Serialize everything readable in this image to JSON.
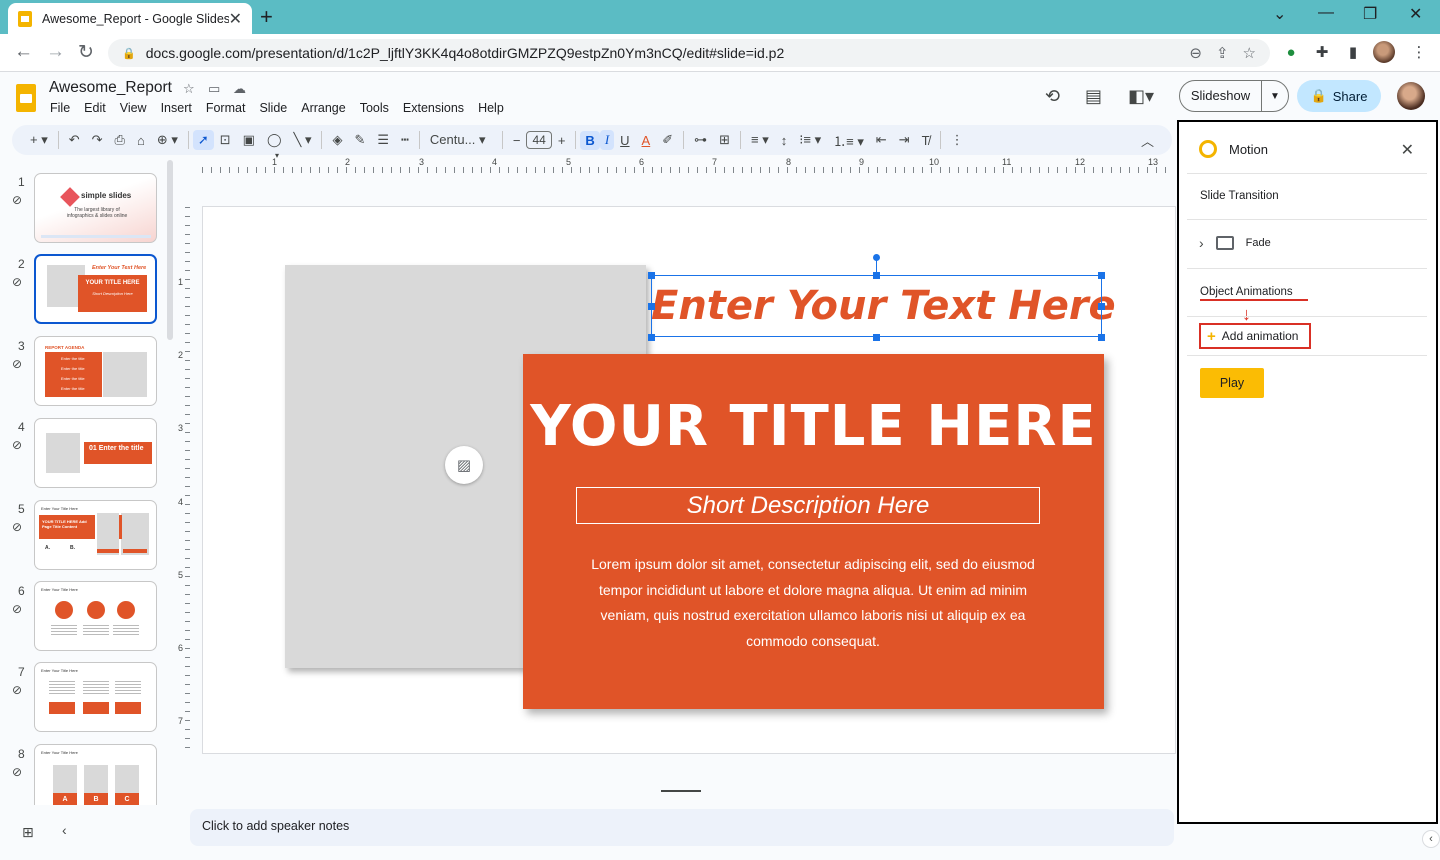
{
  "browser": {
    "tab_title": "Awesome_Report - Google Slides",
    "tab_close": "✕",
    "new_tab": "+",
    "url": "docs.google.com/presentation/d/1c2P_ljftlY3KK4q4o8otdirGMZPZQ9estpZn0Ym3nCQ/edit#slide=id.p2",
    "window_controls": [
      "⌄",
      "—",
      "❐",
      "✕"
    ]
  },
  "app": {
    "doc_title": "Awesome_Report",
    "menu": [
      "File",
      "Edit",
      "View",
      "Insert",
      "Format",
      "Slide",
      "Arrange",
      "Tools",
      "Extensions",
      "Help"
    ],
    "slideshow_label": "Slideshow",
    "share_label": "Share"
  },
  "toolbar": {
    "font_name": "Centu...",
    "font_size": "44"
  },
  "filmstrip": {
    "slide_numbers": [
      "1",
      "2",
      "3",
      "4",
      "5",
      "6",
      "7",
      "8"
    ],
    "selected_index": 2,
    "thumb1_title": "simple slides",
    "thumb1_sub": "The largest library of infographics & slides online",
    "thumb2_heading": "Enter Your Text Here",
    "thumb2_title": "YOUR TITLE HERE",
    "thumb2_sub": "Short Description Here",
    "thumb3_title": "REPORT AGENDA",
    "thumb3_items": [
      "Enter the title",
      "Enter the title",
      "Enter the title",
      "Enter the title"
    ],
    "thumb4_label": "01 Enter the title",
    "thumb5_heading": "Enter Your Title Here",
    "thumb5_text": "YOUR TITLE HERE Add Page Title Content",
    "thumb5_letters": [
      "A.",
      "B."
    ],
    "thumb6_heading": "Enter Your Title Here",
    "thumb7_heading": "Enter Your Title Here",
    "thumb8_heading": "Enter Your Title Here",
    "thumb8_letters": [
      "A",
      "B",
      "C"
    ]
  },
  "ruler": {
    "h": [
      "1",
      "1",
      "2",
      "3",
      "4",
      "5",
      "6",
      "7",
      "8",
      "9",
      "10",
      "11",
      "12",
      "13"
    ],
    "v": [
      "1",
      "2",
      "3",
      "4",
      "5",
      "6",
      "7"
    ]
  },
  "slide": {
    "header_text": "Enter Your Text Here",
    "title": "YOUR TITLE HERE",
    "description": "Short Description Here",
    "body": "Lorem ipsum dolor sit amet, consectetur adipiscing elit, sed do eiusmod tempor incididunt ut labore et dolore magna aliqua. Ut enim ad minim veniam, quis nostrud exercitation ullamco laboris nisi ut aliquip ex ea commodo consequat.",
    "accent_color": "#e05428"
  },
  "notes": {
    "placeholder": "Click to add speaker notes"
  },
  "motion_panel": {
    "title": "Motion",
    "slide_transition_label": "Slide Transition",
    "transition_type": "Fade",
    "object_animations_label": "Object Animations",
    "add_animation_label": "Add animation",
    "play_label": "Play"
  }
}
